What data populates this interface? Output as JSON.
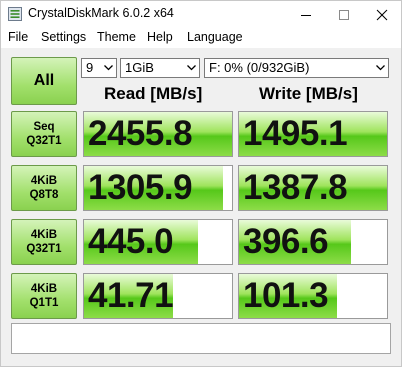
{
  "window": {
    "title": "CrystalDiskMark 6.0.2 x64",
    "controls": {
      "minimize": "minimize-icon",
      "maximize": "maximize-icon",
      "close": "close-icon"
    }
  },
  "menu": [
    "File",
    "Settings",
    "Theme",
    "Help",
    "Language"
  ],
  "toolbar": {
    "all_label": "All",
    "count": "9",
    "size": "1GiB",
    "drive": "F: 0% (0/932GiB)"
  },
  "headers": {
    "read": "Read [MB/s]",
    "write": "Write [MB/s]"
  },
  "tests": [
    {
      "line1": "Seq",
      "line2": "Q32T1",
      "read": "2455.8",
      "write": "1495.1",
      "read_fill": 1.0,
      "write_fill": 1.0
    },
    {
      "line1": "4KiB",
      "line2": "Q8T8",
      "read": "1305.9",
      "write": "1387.8",
      "read_fill": 0.94,
      "write_fill": 1.0
    },
    {
      "line1": "4KiB",
      "line2": "Q32T1",
      "read": "445.0",
      "write": "396.6",
      "read_fill": 0.77,
      "write_fill": 0.76
    },
    {
      "line1": "4KiB",
      "line2": "Q1T1",
      "read": "41.71",
      "write": "101.3",
      "read_fill": 0.6,
      "write_fill": 0.66
    }
  ],
  "comment": "",
  "colors": {
    "accent_green": "#8ad14f",
    "title_bg": "#ffffff",
    "window_bg": "#f0f0f0"
  }
}
